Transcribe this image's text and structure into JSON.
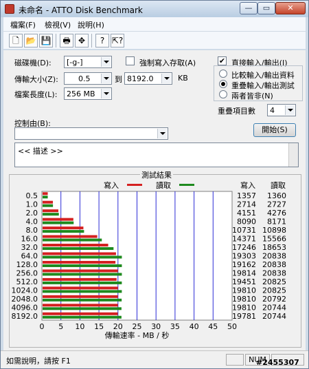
{
  "window": {
    "title": "未命名 - ATTO Disk Benchmark",
    "minimize": "—",
    "maximize": "▭",
    "close": "✕"
  },
  "menu": [
    "檔案(F)",
    "檢視(V)",
    "說明(H)"
  ],
  "toolbar": {
    "icons": [
      "new-icon",
      "open-icon",
      "save-icon",
      "print-icon",
      "move-icon",
      "help-icon",
      "context-help-icon"
    ]
  },
  "settings": {
    "drive_label": "磁碟機(D):",
    "drive_value": "[-g-]",
    "force_write_label": "強制寫入存取(A)",
    "force_write_checked": false,
    "direct_io_label": "直接輸入/輸出(I)",
    "direct_io_checked": true,
    "transfer_size_label": "傳輸大小(Z):",
    "transfer_from": "0.5",
    "to_label": "到",
    "transfer_to": "8192.0",
    "kb_label": "KB",
    "file_length_label": "檔案長度(L):",
    "file_length": "256 MB",
    "modes": [
      "比較輸入/輸出資料",
      "重疊輸入/輸出測試",
      "兩者皆非(N)"
    ],
    "selected_mode": 1,
    "queue_label": "重疊項目數",
    "queue_value": "4",
    "controlled_by_label": "控制由(B):",
    "controlled_by_value": "",
    "start_button": "開始(S)",
    "description": "<< 描述 >>"
  },
  "results": {
    "title": "測試結果",
    "write_legend": "寫入",
    "read_legend": "讀取",
    "write_header": "寫入",
    "read_header": "讀取",
    "xlabel": "傳輸速率 - MB / 秒"
  },
  "colors": {
    "write": "#d42020",
    "read": "#1e8a1e",
    "grid": "#2b2bd6"
  },
  "chart_data": {
    "type": "bar",
    "orientation": "horizontal",
    "title": "測試結果",
    "xlabel": "傳輸速率 - MB / 秒",
    "xlim": [
      0,
      50
    ],
    "xticks": [
      0,
      5,
      10,
      15,
      20,
      25,
      30,
      35,
      40,
      45,
      50
    ],
    "categories": [
      "0.5",
      "1.0",
      "2.0",
      "4.0",
      "8.0",
      "16.0",
      "32.0",
      "64.0",
      "128.0",
      "256.0",
      "512.0",
      "1024.0",
      "2048.0",
      "4096.0",
      "8192.0"
    ],
    "series": [
      {
        "name": "寫入",
        "values": [
          1.36,
          2.71,
          4.15,
          8.09,
          10.73,
          14.37,
          17.25,
          19.3,
          19.16,
          19.81,
          19.45,
          19.81,
          19.81,
          19.81,
          19.78
        ]
      },
      {
        "name": "讀取",
        "values": [
          1.36,
          2.73,
          4.28,
          8.17,
          10.9,
          15.57,
          18.65,
          20.84,
          20.84,
          20.84,
          20.83,
          20.83,
          20.79,
          20.74,
          20.74
        ]
      }
    ],
    "write_numbers": [
      "1357",
      "2714",
      "4151",
      "8090",
      "10731",
      "14371",
      "17246",
      "19303",
      "19162",
      "19814",
      "19451",
      "19810",
      "19810",
      "19810",
      "19781"
    ],
    "read_numbers": [
      "1360",
      "2727",
      "4276",
      "8171",
      "10898",
      "15566",
      "18653",
      "20838",
      "20838",
      "20838",
      "20825",
      "20825",
      "20792",
      "20744",
      "20744"
    ]
  },
  "status": {
    "text": "如需說明，請按 F1",
    "num": "NUM",
    "watermark": "#2455307"
  }
}
